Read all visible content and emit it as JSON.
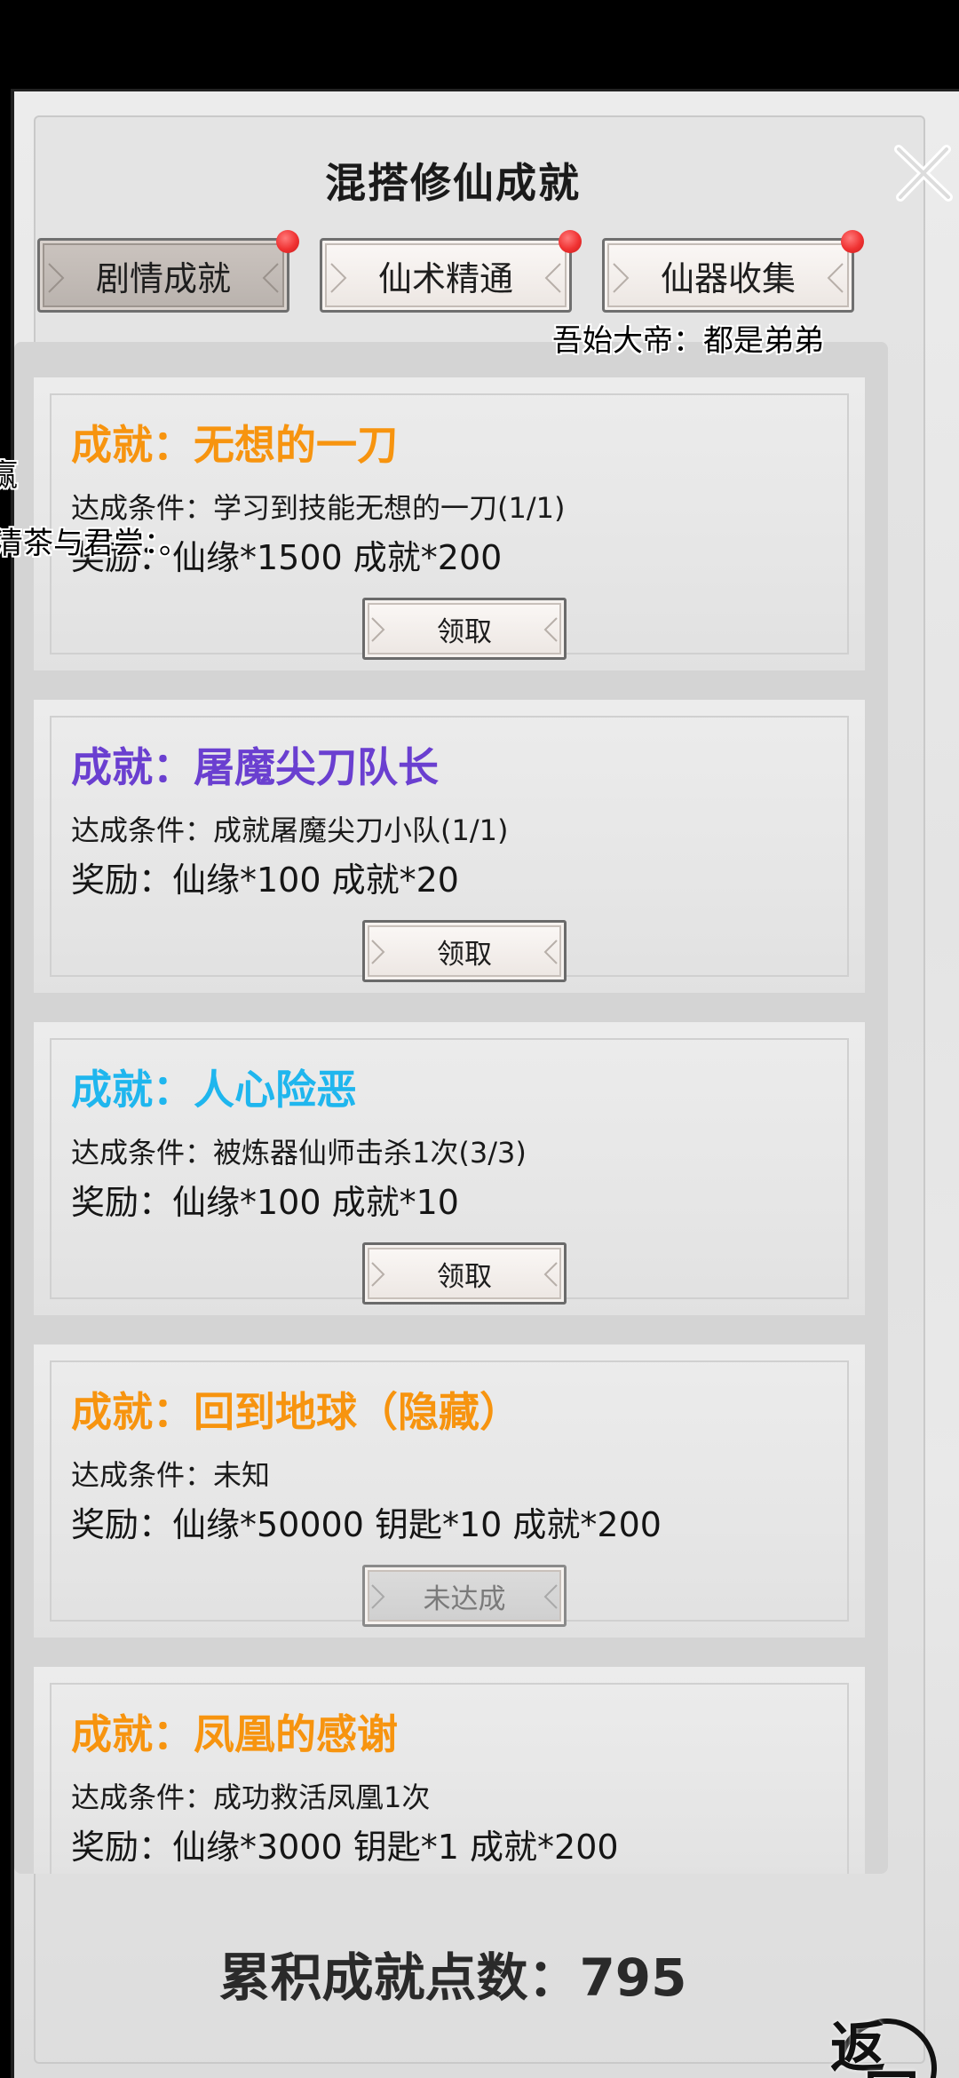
{
  "header": {
    "title": "混搭修仙成就"
  },
  "tabs": [
    {
      "label": "剧情成就",
      "active": true,
      "badge": true
    },
    {
      "label": "仙术精通",
      "active": false,
      "badge": true
    },
    {
      "label": "仙器收集",
      "active": false,
      "badge": true
    }
  ],
  "barrages": [
    {
      "text": "吾始大帝：都是弟弟"
    },
    {
      "text": "赢"
    },
    {
      "text": "清茶与君尝：。"
    }
  ],
  "achievements": [
    {
      "title": "成就：无想的一刀",
      "color": "#f7940f",
      "condition": "达成条件：学习到技能无想的一刀(1/1)",
      "reward": "奖励：仙缘*1500 成就*200",
      "button": "领取",
      "claimable": true
    },
    {
      "title": "成就：屠魔尖刀队长",
      "color": "#6a3fd0",
      "condition": "达成条件：成就屠魔尖刀小队(1/1)",
      "reward": "奖励：仙缘*100 成就*20",
      "button": "领取",
      "claimable": true
    },
    {
      "title": "成就：人心险恶",
      "color": "#1fb6ee",
      "condition": "达成条件：被炼器仙师击杀1次(3/3)",
      "reward": "奖励：仙缘*100 成就*10",
      "button": "领取",
      "claimable": true
    },
    {
      "title": "成就：回到地球（隐藏）",
      "color": "#f7940f",
      "condition": "达成条件：未知",
      "reward": "奖励：仙缘*50000 钥匙*10 成就*200",
      "button": "未达成",
      "claimable": false
    },
    {
      "title": "成就：凤凰的感谢",
      "color": "#f7940f",
      "condition": "达成条件：成功救活凤凰1次",
      "reward": "奖励：仙缘*3000 钥匙*1 成就*200",
      "button": "",
      "claimable": false
    }
  ],
  "footer": {
    "total_label": "累积成就点数：795",
    "back_char1": "返",
    "back_char2": "回"
  },
  "icons": {
    "close": "close-icon",
    "back": "back-icon"
  }
}
